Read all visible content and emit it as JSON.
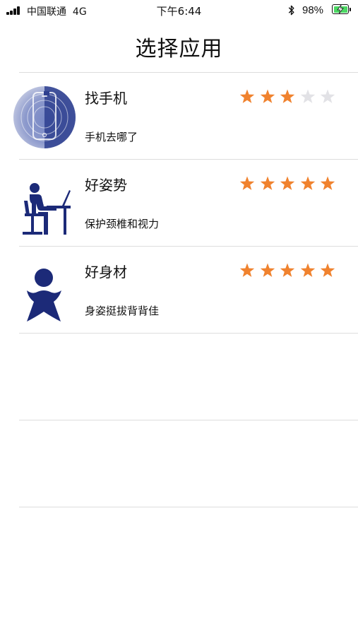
{
  "status_bar": {
    "carrier": "中国联通",
    "network": "4G",
    "time": "下午6:44",
    "battery_percent": "98%"
  },
  "nav": {
    "title": "选择应用"
  },
  "apps": [
    {
      "name": "找手机",
      "description": "手机去哪了",
      "rating": 3,
      "max_rating": 5,
      "icon": "phone-radar-icon"
    },
    {
      "name": "好姿势",
      "description": "保护颈椎和视力",
      "rating": 5,
      "max_rating": 5,
      "icon": "sitting-posture-icon"
    },
    {
      "name": "好身材",
      "description": "身姿挺拔背背佳",
      "rating": 5,
      "max_rating": 5,
      "icon": "body-figure-icon"
    }
  ],
  "colors": {
    "star_filled": "#f0822e",
    "star_empty": "#e2e2e6",
    "icon_navy": "#1c2a78",
    "divider": "#dddddd",
    "battery_green": "#4cd964"
  }
}
